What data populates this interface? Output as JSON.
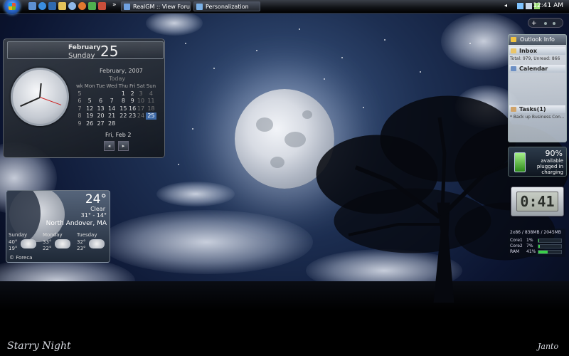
{
  "taskbar": {
    "start_icon": "windows-orb",
    "quicklaunch_icons": [
      "show-desktop-icon",
      "ie-icon",
      "media-icon",
      "folder-icon",
      "search-icon",
      "firefox-icon",
      "messenger-icon",
      "tools-icon"
    ],
    "overflow": "»",
    "windows": [
      {
        "label": "RealGM :: View Foru..."
      },
      {
        "label": "Personalization"
      }
    ],
    "tray_arrow": "◂",
    "time": "12:41 AM"
  },
  "sidebar": {
    "control": "+"
  },
  "calendar_gadget": {
    "month": "February",
    "weekday": "Sunday",
    "day": "25",
    "grid_title": "February, 2007",
    "today_label": "Today",
    "headers": [
      "wk",
      "Mon",
      "Tue",
      "Wed",
      "Thu",
      "Fri",
      "Sat",
      "Sun"
    ],
    "rows": [
      [
        "5",
        "",
        "",
        "",
        "1",
        "2",
        "3",
        "4"
      ],
      [
        "6",
        "5",
        "6",
        "7",
        "8",
        "9",
        "10",
        "11"
      ],
      [
        "7",
        "12",
        "13",
        "14",
        "15",
        "16",
        "17",
        "18"
      ],
      [
        "8",
        "19",
        "20",
        "21",
        "22",
        "23",
        "24",
        "25"
      ],
      [
        "9",
        "26",
        "27",
        "28",
        "",
        "",
        "",
        ""
      ]
    ],
    "footer": "Fri, Feb 2",
    "prev": "◂",
    "next": "▸"
  },
  "weather_gadget": {
    "temperature": "24°",
    "condition": "Clear",
    "range": "31° - 14°",
    "location": "North Andover, MA",
    "forecast": [
      {
        "day": "Sunday",
        "high": "40°",
        "low": "19°"
      },
      {
        "day": "Monday",
        "high": "33°",
        "low": "22°"
      },
      {
        "day": "Tuesday",
        "high": "32°",
        "low": "23°"
      }
    ],
    "provider": "© Foreca"
  },
  "outlook_gadget": {
    "title": "Outlook Info",
    "inbox": "Inbox",
    "inbox_detail": "Total: 979, Unread: 866",
    "calendar": "Calendar",
    "tasks": "Tasks(1)",
    "task_detail": "* Back up Business Con..."
  },
  "battery_gadget": {
    "percent": "90%",
    "available": "available",
    "status1": "plugged in",
    "status2": "charging"
  },
  "digital_clock": {
    "time": "0:41"
  },
  "cpu_meter": {
    "header": "2x86 / 838MB / 2045MB",
    "rows": [
      {
        "label": "Core1",
        "value": "1%",
        "level": 0.01
      },
      {
        "label": "Core2",
        "value": "7%",
        "level": 0.07
      },
      {
        "label": "RAM",
        "value": "41%",
        "level": 0.41
      }
    ]
  },
  "wallpaper": {
    "title": "Starry Night",
    "signature": "Janto"
  },
  "colors": {
    "sky": "#1d2f52",
    "selected_day": "#3e6aa8",
    "meter_fill": "#3bd04a"
  }
}
